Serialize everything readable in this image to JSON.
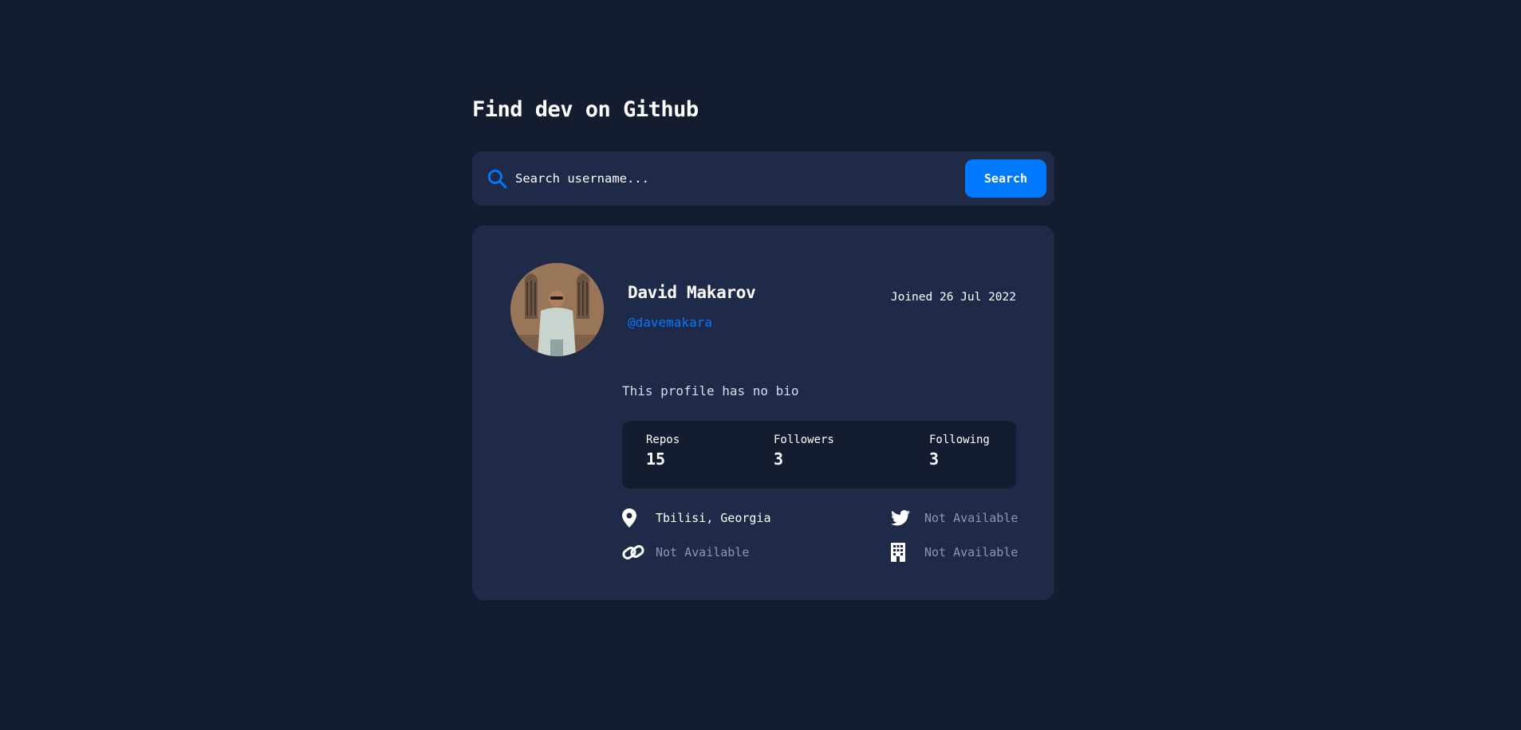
{
  "header": {
    "title": "Find dev on Github"
  },
  "search": {
    "placeholder": "Search username...",
    "value": "",
    "button_label": "Search"
  },
  "colors": {
    "background": "#141d2f",
    "card": "#1e2a47",
    "accent": "#0079ff",
    "muted": "#8d96aa"
  },
  "profile": {
    "name": "David Makarov",
    "handle": "@davemakara",
    "joined": "Joined 26 Jul 2022",
    "bio": "This profile has no bio",
    "avatar_icon": "avatar-photo"
  },
  "stats": [
    {
      "label": "Repos",
      "value": "15"
    },
    {
      "label": "Followers",
      "value": "3"
    },
    {
      "label": "Following",
      "value": "3"
    }
  ],
  "links": {
    "location": {
      "icon": "location-pin-icon",
      "text": "Tbilisi, Georgia"
    },
    "twitter": {
      "icon": "twitter-icon",
      "text": "Not Available"
    },
    "website": {
      "icon": "link-icon",
      "text": "Not Available"
    },
    "company": {
      "icon": "building-icon",
      "text": "Not Available"
    }
  }
}
